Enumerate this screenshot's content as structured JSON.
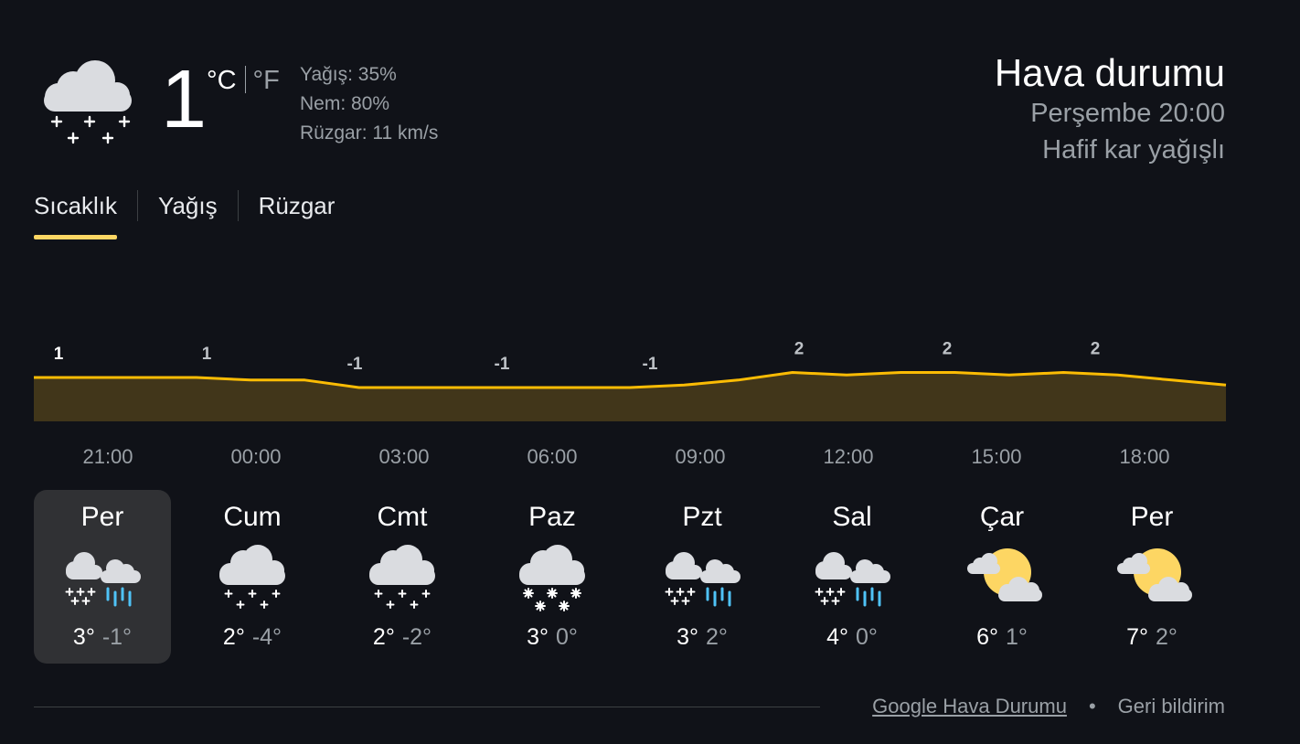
{
  "current": {
    "icon": "light-snow-cloud-icon",
    "temperature": "1",
    "unit_c": "°C",
    "unit_f": "°F",
    "precipitation": "Yağış: 35%",
    "humidity": "Nem: 80%",
    "wind": "Rüzgar: 11 km/s"
  },
  "header": {
    "title": "Hava durumu",
    "datetime": "Perşembe 20:00",
    "condition": "Hafif kar yağışlı"
  },
  "tabs": [
    {
      "label": "Sıcaklık",
      "active": true
    },
    {
      "label": "Yağış",
      "active": false
    },
    {
      "label": "Rüzgar",
      "active": false
    }
  ],
  "colors": {
    "accent": "#fdd663",
    "chart_line": "#fbbc04",
    "chart_fill": "#41361a",
    "background": "#101218",
    "selected_day": "#303134"
  },
  "chart_data": {
    "type": "area",
    "x": [
      "21:00",
      "00:00",
      "03:00",
      "06:00",
      "09:00",
      "12:00",
      "15:00",
      "18:00"
    ],
    "data_labels": [
      "1",
      "1",
      "-1",
      "-1",
      "-1",
      "2",
      "2",
      "2"
    ],
    "ylim": [
      -10,
      10
    ],
    "line_points": [
      1,
      1,
      1,
      1,
      0.5,
      0.5,
      -1,
      -1,
      -1,
      -1,
      -1,
      -1,
      -0.5,
      0.5,
      2,
      1.5,
      2,
      2,
      1.5,
      2,
      1.5,
      0.5,
      -0.5
    ],
    "x_ticks": [
      "21:00",
      "00:00",
      "03:00",
      "06:00",
      "09:00",
      "12:00",
      "15:00",
      "18:00"
    ]
  },
  "days": [
    {
      "name": "Per",
      "icon": "snow-rain-icon",
      "high": "3°",
      "low": "-1°",
      "selected": true
    },
    {
      "name": "Cum",
      "icon": "snow-cloud-icon",
      "high": "2°",
      "low": "-4°",
      "selected": false
    },
    {
      "name": "Cmt",
      "icon": "snow-cloud-icon",
      "high": "2°",
      "low": "-2°",
      "selected": false
    },
    {
      "name": "Paz",
      "icon": "heavy-snow-cloud-icon",
      "high": "3°",
      "low": "0°",
      "selected": false
    },
    {
      "name": "Pzt",
      "icon": "snow-rain-icon",
      "high": "3°",
      "low": "2°",
      "selected": false
    },
    {
      "name": "Sal",
      "icon": "snow-rain-icon",
      "high": "4°",
      "low": "0°",
      "selected": false
    },
    {
      "name": "Çar",
      "icon": "partly-cloudy-icon",
      "high": "6°",
      "low": "1°",
      "selected": false
    },
    {
      "name": "Per",
      "icon": "partly-cloudy-icon",
      "high": "7°",
      "low": "2°",
      "selected": false
    }
  ],
  "footer": {
    "source_link": "Google Hava Durumu",
    "separator": "•",
    "feedback": "Geri bildirim"
  }
}
